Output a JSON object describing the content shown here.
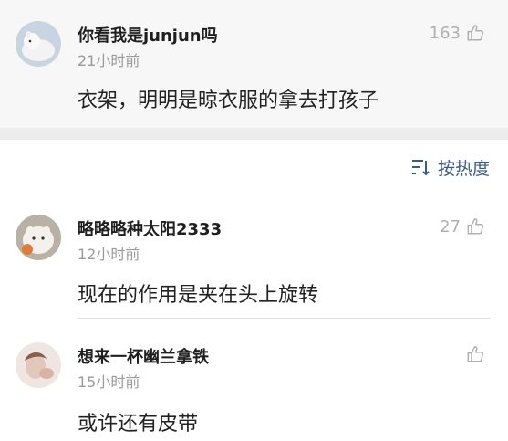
{
  "top_comment": {
    "username": "你看我是junjun吗",
    "time": "21小时前",
    "text": "衣架，明明是晾衣服的拿去打孩子",
    "likes": "163"
  },
  "sort_button": {
    "label": "按热度"
  },
  "comments": [
    {
      "username": "略略略种太阳2333",
      "time": "12小时前",
      "text": "现在的作用是夹在头上旋转",
      "likes": "27"
    },
    {
      "username": "想来一杯幽兰拿铁",
      "time": "15小时前",
      "text": "或许还有皮带",
      "likes": ""
    }
  ],
  "icons": {
    "like": "thumbs-up-icon",
    "sort": "sort-lines-icon"
  },
  "colors": {
    "accent": "#3b5b85",
    "muted": "#9a9a9a",
    "top_card_bg": "#f7f7f7",
    "separator": "#ececec"
  }
}
